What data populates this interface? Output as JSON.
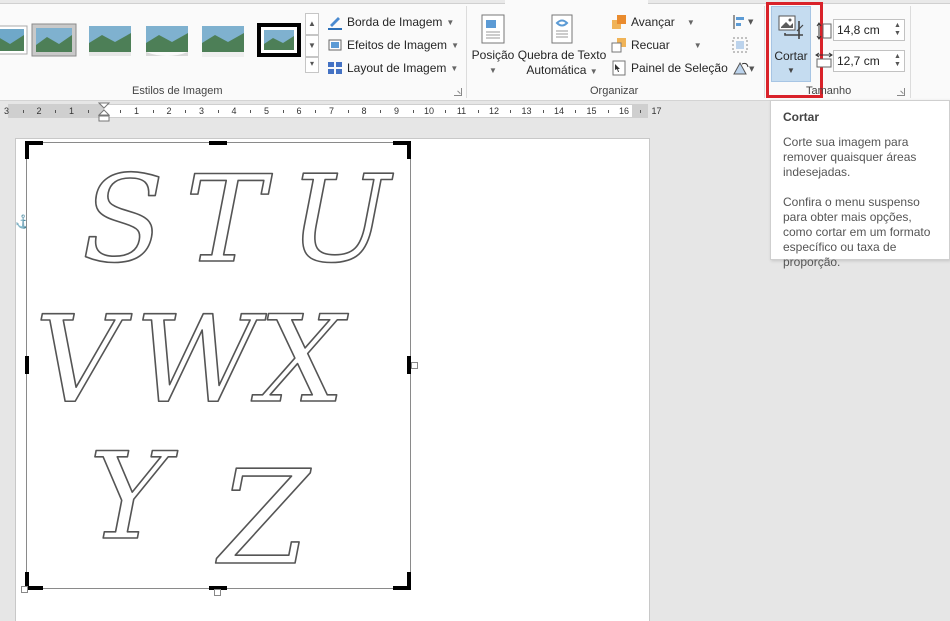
{
  "colors": {
    "accent_blue": "#2b579a",
    "crop_pressed": "#c5dcf0",
    "annotation_red": "#d9222a"
  },
  "ribbon": {
    "groups": {
      "picture_styles": {
        "label": "Estilos de Imagem"
      },
      "arrange": {
        "label": "Organizar"
      },
      "size": {
        "label": "Tamanho"
      }
    },
    "picture_style_commands": [
      {
        "label": "Borda de Imagem",
        "icon": "picture-border-icon"
      },
      {
        "label": "Efeitos de Imagem",
        "icon": "picture-effects-icon"
      },
      {
        "label": "Layout de Imagem",
        "icon": "picture-layout-icon"
      }
    ],
    "position_button": {
      "label": "Posição"
    },
    "wrap_text_button": {
      "line1": "Quebra de Texto",
      "line2": "Automática"
    },
    "arrange_commands": [
      {
        "label": "Avançar",
        "icon": "bring-forward-icon"
      },
      {
        "label": "Recuar",
        "icon": "send-backward-icon"
      },
      {
        "label": "Painel de Seleção",
        "icon": "selection-pane-icon"
      }
    ],
    "crop_button": {
      "label": "Cortar"
    },
    "size_fields": {
      "height": "14,8 cm",
      "width": "12,7 cm"
    }
  },
  "ruler": {
    "numbers": [
      "3",
      "2",
      "1",
      "1",
      "2",
      "3",
      "4",
      "5",
      "6",
      "7",
      "8",
      "9",
      "10",
      "11",
      "12",
      "13",
      "14",
      "15",
      "16",
      "17"
    ]
  },
  "tooltip": {
    "title": "Cortar",
    "paragraph1": "Corte sua imagem para remover quaisquer áreas indesejadas.",
    "paragraph2": "Confira o menu suspenso para obter mais opções, como cortar em um formato específico ou taxa de proporção."
  },
  "document": {
    "image_letters": [
      "S",
      "T",
      "U",
      "V",
      "W",
      "X",
      "Y",
      "Z"
    ]
  }
}
